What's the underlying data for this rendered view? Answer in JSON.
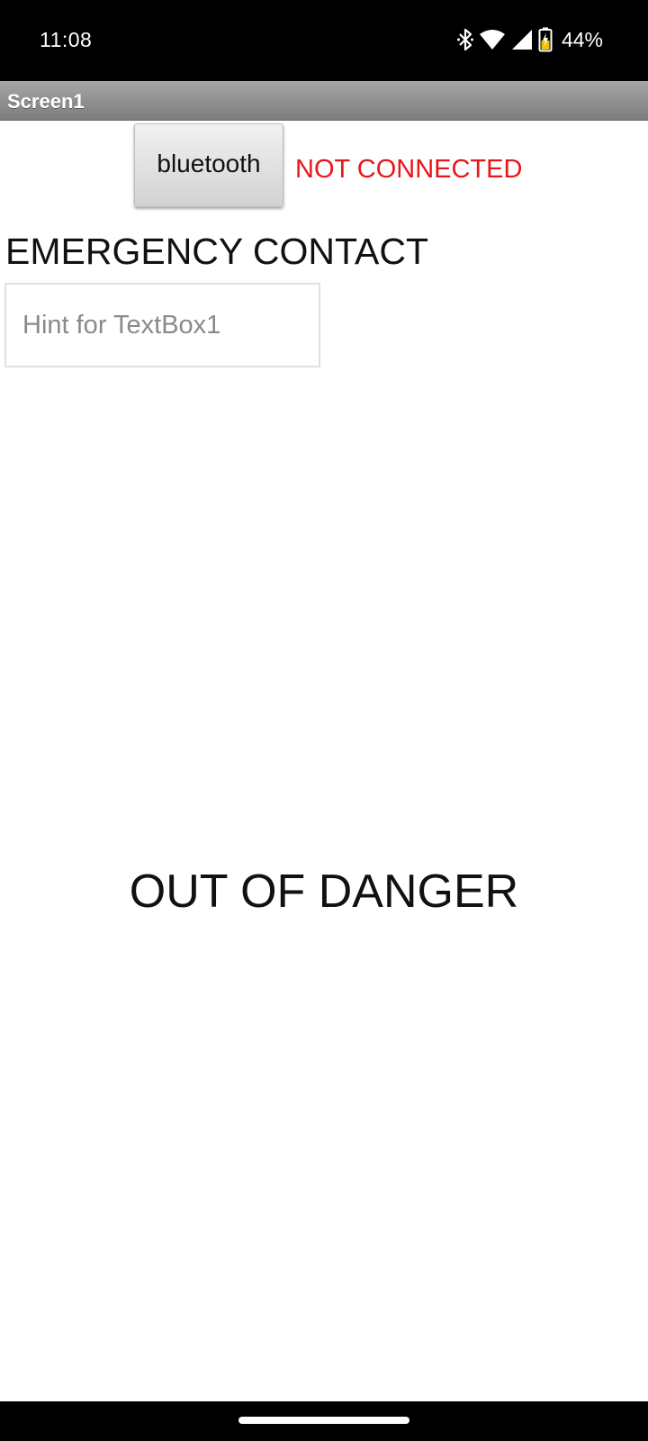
{
  "status_bar": {
    "time": "11:08",
    "battery_percent": "44%",
    "icons": [
      "bluetooth-icon",
      "wifi-icon",
      "cell-signal-icon",
      "battery-charging-icon"
    ]
  },
  "title_bar": {
    "title": "Screen1"
  },
  "main": {
    "bluetooth_button_label": "bluetooth",
    "connection_status": "NOT CONNECTED",
    "emergency_label": "EMERGENCY CONTACT",
    "contact_input": {
      "value": "",
      "placeholder": "Hint for TextBox1"
    },
    "danger_status": "OUT OF DANGER"
  },
  "colors": {
    "status_bar_bg": "#000000",
    "title_bar_bg": "#8c8c8c",
    "not_connected_text": "#e8161a",
    "background": "#ffffff"
  }
}
